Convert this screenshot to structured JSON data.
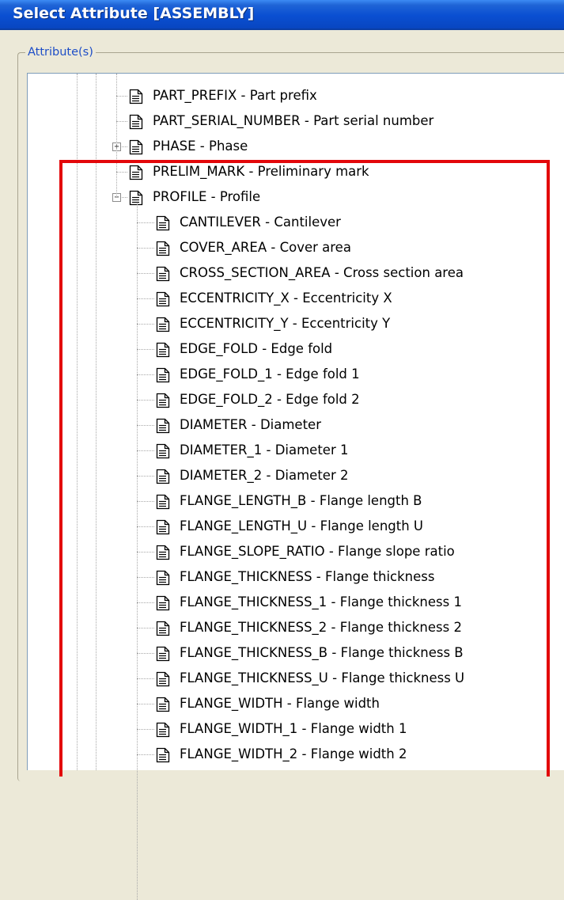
{
  "window": {
    "title": "Select Attribute [ASSEMBLY]"
  },
  "group": {
    "label": "Attribute(s)"
  },
  "tree": {
    "top_items": [
      {
        "name": "PART_PREFIX",
        "desc": "Part prefix",
        "expander": ""
      },
      {
        "name": "PART_SERIAL_NUMBER",
        "desc": "Part serial number",
        "expander": ""
      },
      {
        "name": "PHASE",
        "desc": "Phase",
        "expander": "+"
      },
      {
        "name": "PRELIM_MARK",
        "desc": "Preliminary mark",
        "expander": ""
      },
      {
        "name": "PROFILE",
        "desc": "Profile",
        "expander": "−"
      }
    ],
    "profile_children": [
      {
        "name": "CANTILEVER",
        "desc": "Cantilever"
      },
      {
        "name": "COVER_AREA",
        "desc": "Cover area"
      },
      {
        "name": "CROSS_SECTION_AREA",
        "desc": "Cross section area"
      },
      {
        "name": "ECCENTRICITY_X",
        "desc": "Eccentricity X"
      },
      {
        "name": "ECCENTRICITY_Y",
        "desc": "Eccentricity Y"
      },
      {
        "name": "EDGE_FOLD",
        "desc": "Edge fold"
      },
      {
        "name": "EDGE_FOLD_1",
        "desc": "Edge fold 1"
      },
      {
        "name": "EDGE_FOLD_2",
        "desc": "Edge fold 2"
      },
      {
        "name": "DIAMETER",
        "desc": "Diameter"
      },
      {
        "name": "DIAMETER_1",
        "desc": "Diameter 1"
      },
      {
        "name": "DIAMETER_2",
        "desc": "Diameter 2"
      },
      {
        "name": "FLANGE_LENGTH_B",
        "desc": "Flange length B"
      },
      {
        "name": "FLANGE_LENGTH_U",
        "desc": "Flange length U"
      },
      {
        "name": "FLANGE_SLOPE_RATIO",
        "desc": "Flange slope ratio"
      },
      {
        "name": "FLANGE_THICKNESS",
        "desc": "Flange thickness"
      },
      {
        "name": "FLANGE_THICKNESS_1",
        "desc": "Flange thickness 1"
      },
      {
        "name": "FLANGE_THICKNESS_2",
        "desc": "Flange thickness 2"
      },
      {
        "name": "FLANGE_THICKNESS_B",
        "desc": "Flange thickness B"
      },
      {
        "name": "FLANGE_THICKNESS_U",
        "desc": "Flange thickness U"
      },
      {
        "name": "FLANGE_WIDTH",
        "desc": "Flange width"
      },
      {
        "name": "FLANGE_WIDTH_1",
        "desc": "Flange width 1"
      },
      {
        "name": "FLANGE_WIDTH_2",
        "desc": "Flange width 2"
      }
    ],
    "separator": " - "
  },
  "colors": {
    "title_bar": "#0a4fd2",
    "highlight_border": "#e3070a",
    "group_label": "#1e4ec7"
  },
  "icons": {
    "item": "document-icon",
    "expand": "plus-box-icon",
    "collapse": "minus-box-icon"
  }
}
